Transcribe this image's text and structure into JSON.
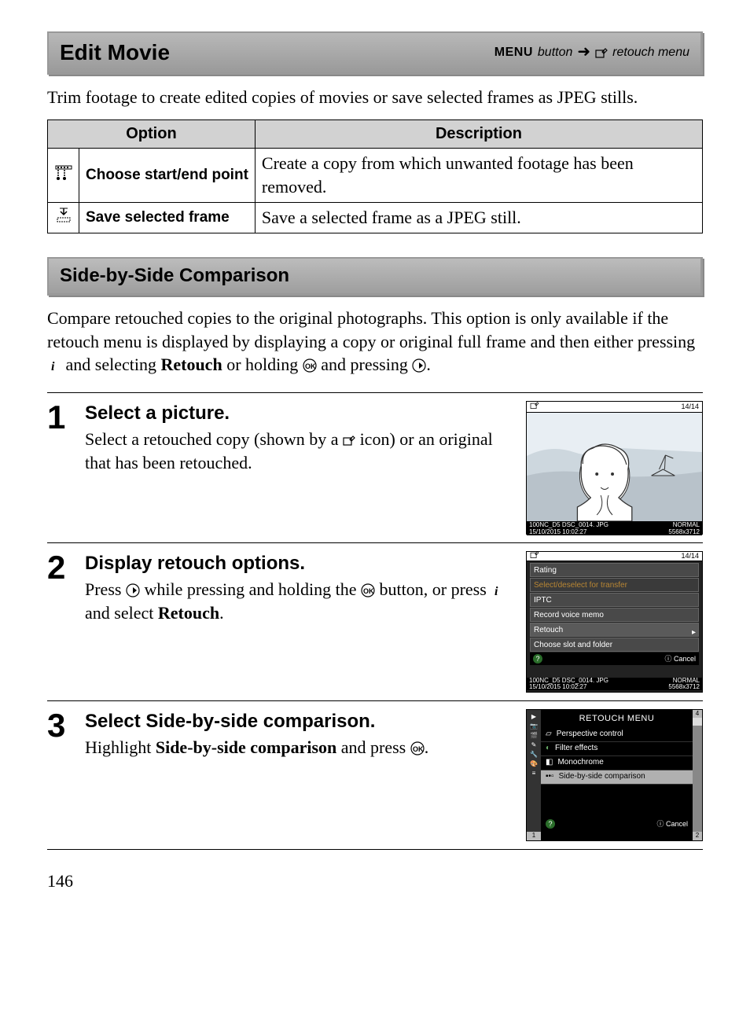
{
  "header": {
    "title": "Edit Movie",
    "menu_label": "MENU",
    "button_word": "button",
    "retouch_menu": "retouch menu"
  },
  "intro_text": "Trim footage to create edited copies of movies or save selected frames as JPEG stills.",
  "table": {
    "col_option": "Option",
    "col_desc": "Description",
    "rows": [
      {
        "label": "Choose start/end point",
        "desc": "Create a copy from which unwanted footage has been removed."
      },
      {
        "label": "Save selected frame",
        "desc": "Save a selected frame as a JPEG still."
      }
    ]
  },
  "section2": {
    "title": "Side-by-Side Comparison",
    "intro_a": "Compare retouched copies to the original photographs.  This option is only available if the retouch menu is displayed by displaying a copy or original full frame and then either pressing ",
    "intro_b": " and selecting ",
    "retouch_word": "Retouch",
    "intro_c": " or holding ",
    "intro_d": " and pressing ",
    "intro_e": "."
  },
  "steps": [
    {
      "num": "1",
      "title": "Select a picture.",
      "text_a": "Select a retouched copy (shown by a ",
      "text_b": " icon) or an original that has been retouched."
    },
    {
      "num": "2",
      "title": "Display retouch options.",
      "text_a": "Press ",
      "text_b": " while pressing and holding the ",
      "text_c": " button, or press ",
      "text_d": " and select ",
      "retouch": "Retouch",
      "text_e": "."
    },
    {
      "num": "3",
      "title_a": "Select ",
      "title_b": "Side-by-side comparison",
      "title_c": ".",
      "text_a": "Highlight ",
      "text_b": "Side-by-side comparison",
      "text_c": " and press ",
      "text_d": "."
    }
  ],
  "screen1": {
    "counter": "14/14",
    "folder": "100NC_D5",
    "file": "DSC_0014. JPG",
    "date": "15/10/2015 10:02:27",
    "qual": "NORMAL",
    "size": "5568x3712"
  },
  "screen2": {
    "counter": "14/14",
    "items": [
      "Rating",
      "Select/deselect for transfer",
      "IPTC",
      "Record voice memo",
      "Retouch",
      "Choose slot and folder"
    ],
    "cancel": "Cancel",
    "folder": "100NC_D5 DSC_0014. JPG",
    "date": "15/10/2015 10:02:27",
    "qual": "NORMAL",
    "size": "5568x3712"
  },
  "screen3": {
    "title": "RETOUCH MENU",
    "items": [
      "Perspective control",
      "Filter effects",
      "Monochrome",
      "Side-by-side comparison"
    ],
    "cancel": "Cancel",
    "page_indicator": "4",
    "left_page": "1",
    "right_page": "2"
  },
  "page_number": "146"
}
